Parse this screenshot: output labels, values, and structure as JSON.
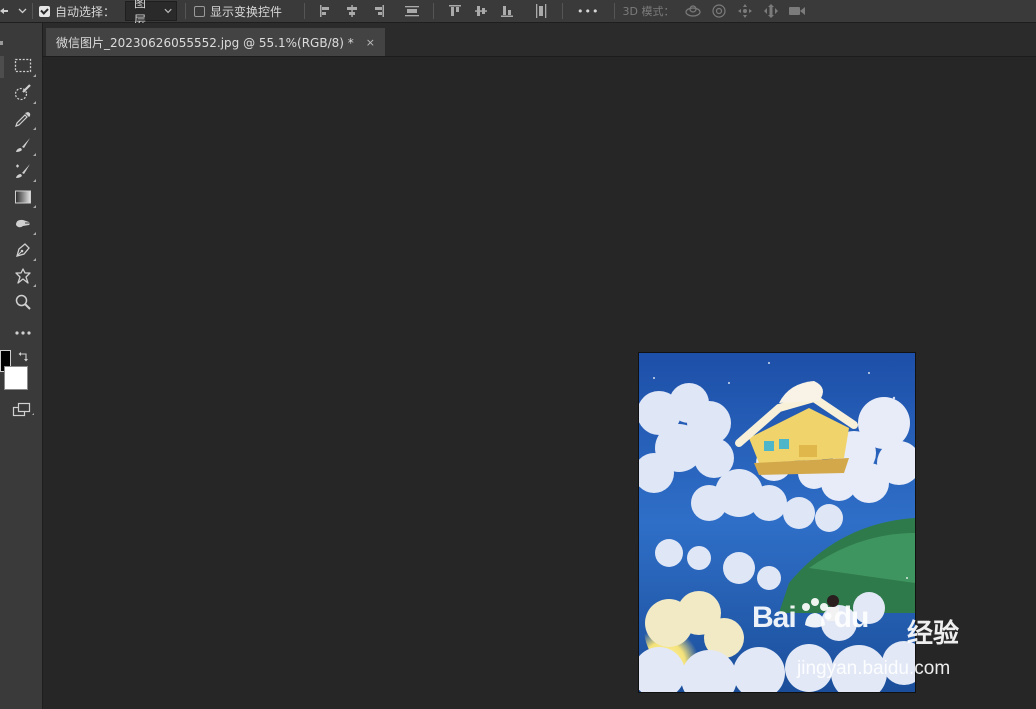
{
  "options_bar": {
    "auto_select_label": "自动选择：",
    "auto_select_checked": true,
    "layer_select_value": "图层",
    "show_transform_label": "显示变换控件",
    "show_transform_checked": false,
    "more_label": "•••",
    "mode_3d_label": "3D 模式："
  },
  "document_tab": {
    "title": "微信图片_20230626055552.jpg @ 55.1%(RGB/8) *",
    "close_glyph": "×"
  },
  "tools": [
    {
      "name": "marquee-tool-icon"
    },
    {
      "name": "quick-selection-tool-icon"
    },
    {
      "name": "eyedropper-tool-icon"
    },
    {
      "name": "brush-tool-icon"
    },
    {
      "name": "history-brush-tool-icon"
    },
    {
      "name": "gradient-tool-icon"
    },
    {
      "name": "smudge-tool-icon"
    },
    {
      "name": "pen-tool-icon"
    },
    {
      "name": "custom-shape-tool-icon"
    },
    {
      "name": "zoom-tool-icon"
    },
    {
      "name": "more-tools-icon"
    }
  ],
  "colors": {
    "foreground": "#000000",
    "background": "#ffffff"
  },
  "watermark": {
    "brand_prefix": "Bai",
    "brand_suffix": "du",
    "chinese": "经验",
    "url": "jingyan.baidu.com"
  }
}
